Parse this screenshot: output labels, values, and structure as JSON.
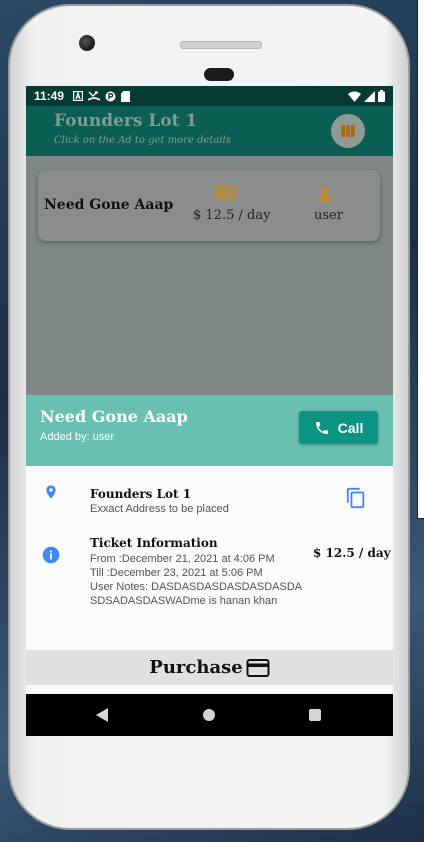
{
  "status_bar": {
    "time": "11:49",
    "left_icons": [
      "a-square-icon",
      "missed-call-icon",
      "p-circle-icon",
      "sd-card-icon"
    ],
    "right_icons": [
      "wifi-icon",
      "signal-icon",
      "battery-icon"
    ]
  },
  "app_bar": {
    "title": "Founders Lot 1",
    "subtitle": "Click on the Ad to get more details",
    "map_icon": "map-icon"
  },
  "ad_card": {
    "name": "Need Gone Aaap",
    "price": "$ 12.5 / day",
    "user": "user",
    "price_icon": "money-icon",
    "user_icon": "person-icon"
  },
  "sheet": {
    "title": "Need Gone Aaap",
    "added_by": "Added by: user",
    "call_label": "Call",
    "location": {
      "title": "Founders Lot 1",
      "subtitle": "Exxact Address to be placed"
    },
    "ticket": {
      "title": "Ticket Information",
      "from": "From :December 21, 2021 at  4:06 PM",
      "till": "Till :December 23, 2021 at  5:06 PM",
      "notes": "User Notes: DASDASDASDASDASDASDASDSADASDASWADme is hanan khan",
      "price": "$ 12.5 / day"
    },
    "purchase_label": "Purchase"
  },
  "colors": {
    "status_bar": "#063a33",
    "app_bar": "#0b5e53",
    "sheet_header": "#68bfb2",
    "call_button": "#0b9383",
    "accent_blue": "#4285f4",
    "ad_icon_orange": "#c98a1c"
  }
}
